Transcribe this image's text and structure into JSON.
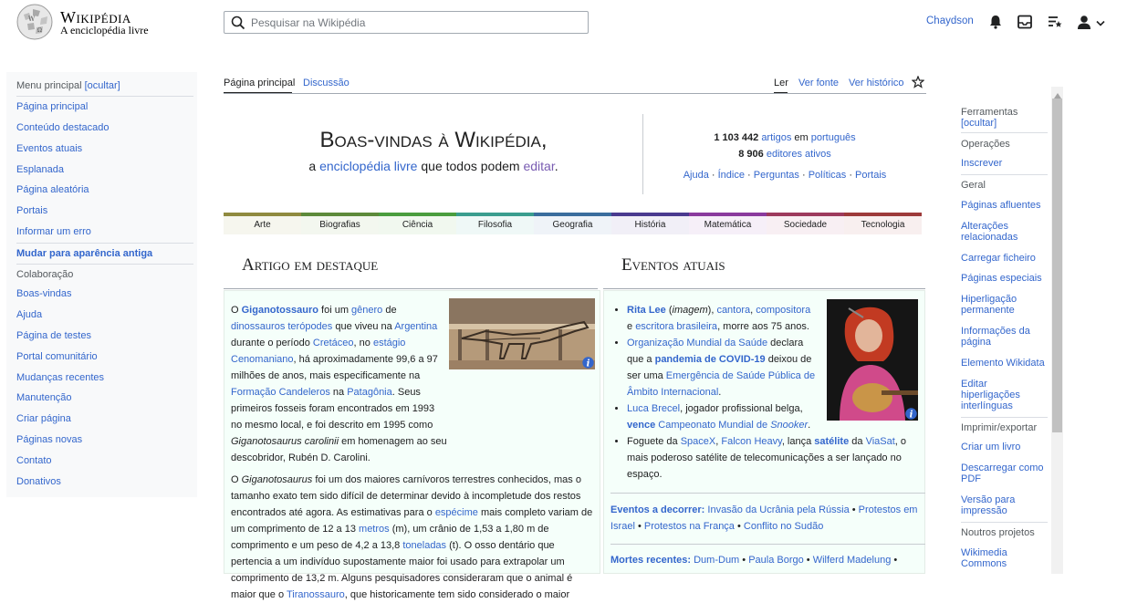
{
  "header": {
    "wordmark": "Wikipédia",
    "tagline": "A enciclopédia livre",
    "search_placeholder": "Pesquisar na Wikipédia",
    "username": "Chaydson"
  },
  "left_sidebar": {
    "menu_heading": "Menu principal",
    "hide_label": "[ocultar]",
    "items": [
      "Página principal",
      "Conteúdo destacado",
      "Eventos atuais",
      "Esplanada",
      "Página aleatória",
      "Portais",
      "Informar um erro"
    ],
    "old_look": "Mudar para aparência antiga",
    "collab_heading": "Colaboração",
    "collab_items": [
      "Boas-vindas",
      "Ajuda",
      "Página de testes",
      "Portal comunitário",
      "Mudanças recentes",
      "Manutenção",
      "Criar página",
      "Páginas novas",
      "Contato",
      "Donativos"
    ]
  },
  "tabs": {
    "main_page": "Página principal",
    "discussion": "Discussão",
    "read": "Ler",
    "view_source": "Ver fonte",
    "history": "Ver histórico"
  },
  "welcome": {
    "title": "Boas-vindas à Wikipédia,",
    "sub_a": "a ",
    "sub_link1": "enciclopédia livre",
    "sub_b": " que todos podem ",
    "sub_link2": "editar",
    "sub_c": ".",
    "articles_count": "1 103 442",
    "articles_label": "artigos",
    "articles_in": " em ",
    "articles_lang": "português",
    "editors_count": "8 906",
    "editors_label": "editores ativos",
    "links": [
      "Ajuda",
      "Índice",
      "Perguntas",
      "Políticas",
      "Portais"
    ]
  },
  "categories": [
    {
      "label": "Arte",
      "color": "#8f8a3f"
    },
    {
      "label": "Biografias",
      "color": "#5d8a3a"
    },
    {
      "label": "Ciência",
      "color": "#4a9d3e"
    },
    {
      "label": "Filosofia",
      "color": "#3a9d8e"
    },
    {
      "label": "Geografia",
      "color": "#3a6d9d"
    },
    {
      "label": "História",
      "color": "#4a3a8f"
    },
    {
      "label": "Matemática",
      "color": "#8a3a9d"
    },
    {
      "label": "Sociedade",
      "color": "#9d3a5d"
    },
    {
      "label": "Tecnologia",
      "color": "#9d3a3a"
    }
  ],
  "featured": {
    "heading": "Artigo em destaque",
    "p1": [
      {
        "t": "O "
      },
      {
        "b": "Giganotossauro"
      },
      {
        "t": " foi um "
      },
      {
        "a": "gênero"
      },
      {
        "t": " de "
      },
      {
        "a": "dinossauros terópodes"
      },
      {
        "t": " que viveu na "
      },
      {
        "a": "Argentina"
      },
      {
        "t": " durante o período "
      },
      {
        "a": "Cretáceo"
      },
      {
        "t": ", no "
      },
      {
        "a": "estágio Cenomaniano"
      },
      {
        "t": ", há aproximadamente 99,6 a 97 milhões de anos, mais especificamente na "
      },
      {
        "a": "Formação Candeleros"
      },
      {
        "t": " na "
      },
      {
        "a": "Patagônia"
      },
      {
        "t": ". Seus primeiros fosseis foram encontrados em 1993 no mesmo local, e foi descrito em 1995 como "
      },
      {
        "i": "Giganotosaurus carolinii"
      },
      {
        "t": " em homenagem ao seu descobridor, Rubén D. Carolini."
      }
    ],
    "p2": [
      {
        "t": "O "
      },
      {
        "i": "Giganotosaurus"
      },
      {
        "t": " foi um dos maiores carnívoros terrestres conhecidos, mas o tamanho exato tem sido difícil de determinar devido à incompletude dos restos encontrados até agora. As estimativas para o "
      },
      {
        "a": "espécime"
      },
      {
        "t": " mais completo variam de um comprimento de 12 a 13 "
      },
      {
        "a": "metros"
      },
      {
        "t": " (m), um crânio de 1,53 a 1,80 m de comprimento e um peso de 4,2 a 13,8 "
      },
      {
        "a": "toneladas"
      },
      {
        "t": " (t). O osso dentário que pertencia a um indivíduo supostamente maior foi usado para extrapolar um comprimento de 13,2 m. Alguns pesquisadores consideraram que o animal é maior que o "
      },
      {
        "a": "Tiranossauro"
      },
      {
        "t": ", que historicamente tem sido considerado o maior"
      }
    ]
  },
  "events": {
    "heading": "Eventos atuais",
    "items": [
      [
        {
          "ab": "Rita Lee"
        },
        {
          "t": " ("
        },
        {
          "i": "imagem"
        },
        {
          "t": "), "
        },
        {
          "a": "cantora"
        },
        {
          "t": ", "
        },
        {
          "a": "compositora"
        },
        {
          "t": " e "
        },
        {
          "a": "escritora brasileira"
        },
        {
          "t": ", morre aos 75 anos."
        }
      ],
      [
        {
          "a": "Organização Mundial da Saúde"
        },
        {
          "t": " declara que a "
        },
        {
          "ab": "pandemia de COVID-19"
        },
        {
          "t": " deixou de ser uma "
        },
        {
          "a": "Emergência de Saúde Pública de Âmbito Internacional"
        },
        {
          "t": "."
        }
      ],
      [
        {
          "a": "Luca Brecel"
        },
        {
          "t": ", jogador profissional belga, "
        },
        {
          "ab": "vence"
        },
        {
          "t": " "
        },
        {
          "a": "Campeonato Mundial de "
        },
        {
          "ai": "Snooker"
        },
        {
          "t": "."
        }
      ],
      [
        {
          "t": "Foguete da "
        },
        {
          "a": "SpaceX"
        },
        {
          "t": ", "
        },
        {
          "a": "Falcon Heavy"
        },
        {
          "t": ", lança "
        },
        {
          "ab": "satélite"
        },
        {
          "t": " da "
        },
        {
          "a": "ViaSat"
        },
        {
          "t": ", o mais poderoso satélite de telecomunicações a ser lançado no espaço."
        }
      ]
    ],
    "ongoing_label": "Eventos a decorrer:",
    "ongoing": [
      "Invasão da Ucrânia pela Rússia",
      "Protestos em Israel",
      "Protestos na França",
      "Conflito no Sudão"
    ],
    "deaths_label": "Mortes recentes:",
    "deaths": [
      "Dum-Dum",
      "Paula Borgo",
      "Wilferd Madelung"
    ]
  },
  "right_sidebar": {
    "tools_heading": "Ferramentas",
    "hide_label": "[ocultar]",
    "operations_heading": "Operações",
    "watch": "Inscrever",
    "general_heading": "Geral",
    "general_items": [
      "Páginas afluentes",
      "Alterações relacionadas",
      "Carregar ficheiro",
      "Páginas especiais",
      "Hiperligação permanente",
      "Informações da página",
      "Elemento Wikidata",
      "Editar hiperligações interlínguas"
    ],
    "print_heading": "Imprimir/exportar",
    "print_items": [
      "Criar um livro",
      "Descarregar como PDF",
      "Versão para impressão"
    ],
    "projects_heading": "Noutros projetos",
    "projects_items": [
      "Wikimedia Commons"
    ]
  },
  "icons": [
    "wikipedia-globe-icon",
    "search-icon",
    "bell-icon",
    "inbox-icon",
    "watchlist-icon",
    "user-icon",
    "chevron-down-icon",
    "star-icon",
    "info-icon"
  ]
}
